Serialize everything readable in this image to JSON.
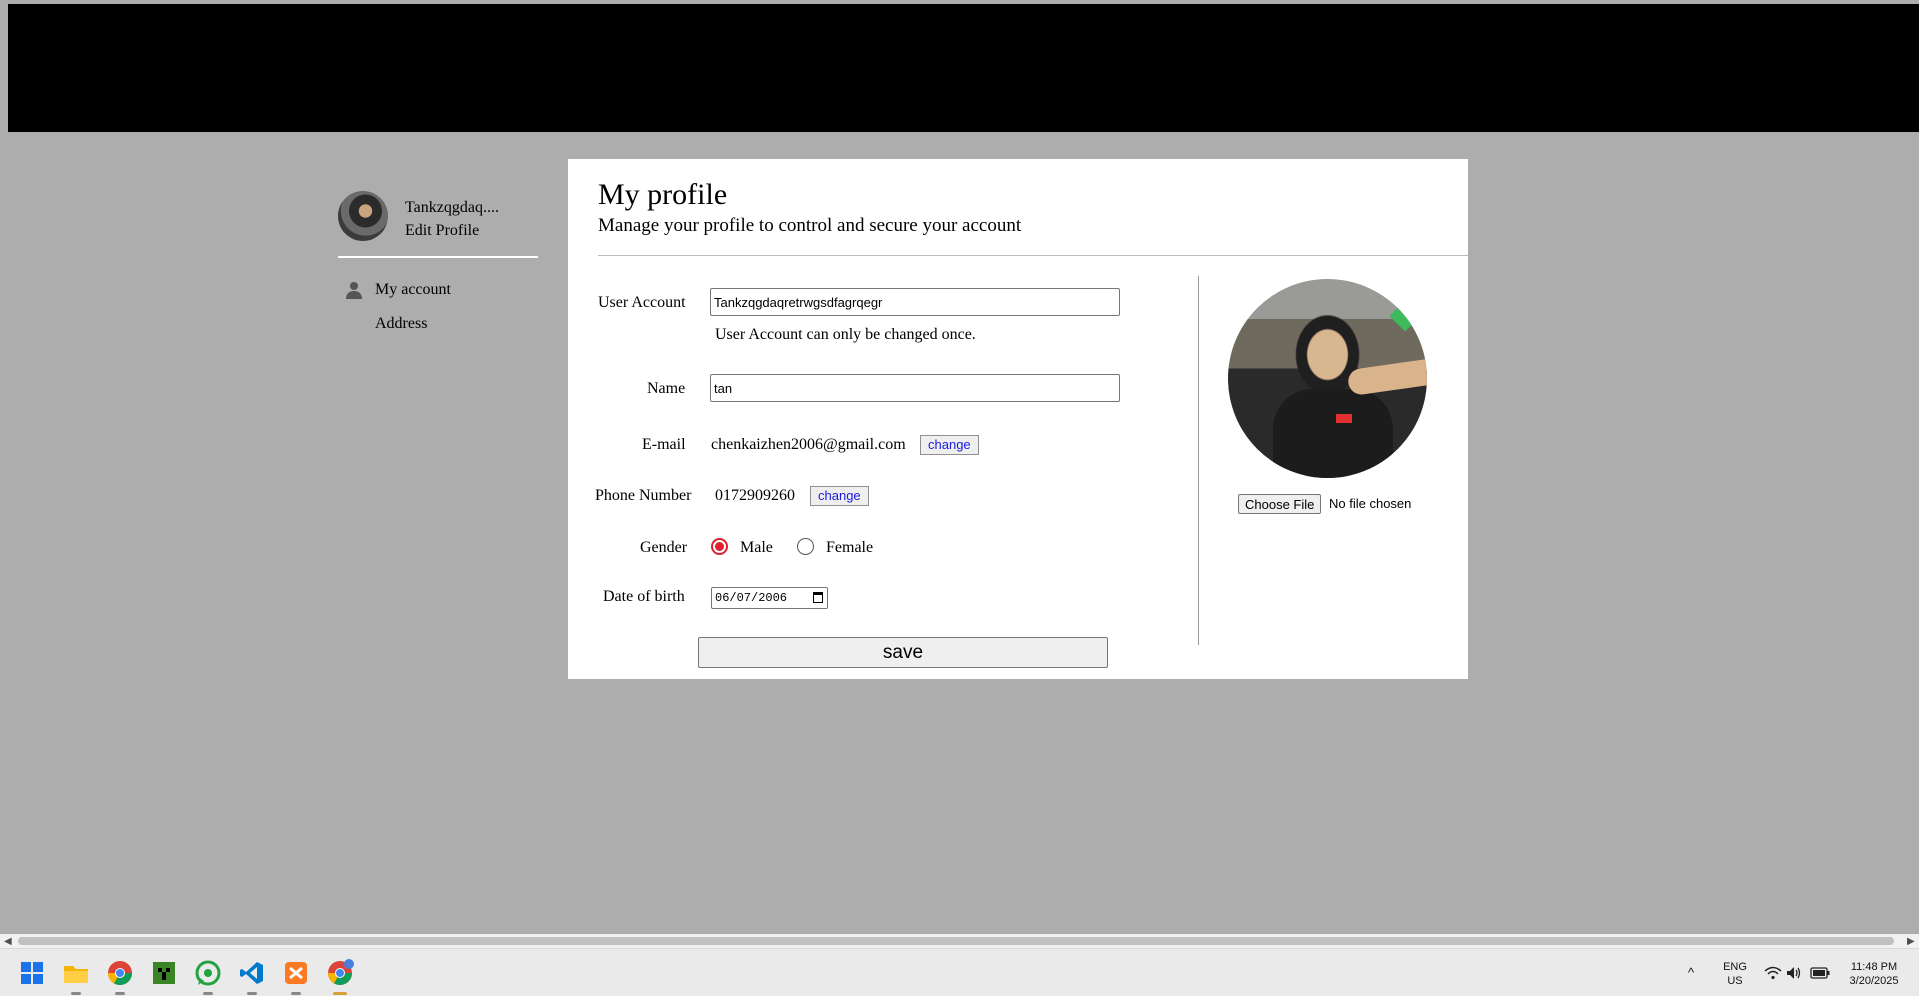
{
  "sidebar": {
    "username": "Tankzqgdaq....",
    "edit_profile": "Edit Profile",
    "items": [
      {
        "label": "My account",
        "icon": "person-icon"
      },
      {
        "label": "Address"
      }
    ]
  },
  "profile": {
    "title": "My profile",
    "subtitle": "Manage your profile to control and secure your account",
    "fields": {
      "user_account_label": "User Account",
      "user_account_value": "Tankzqgdaqretrwgsdfagrqegr",
      "user_account_note": "User Account can only be changed once.",
      "name_label": "Name",
      "name_value": "tan",
      "email_label": "E-mail",
      "email_value": "chenkaizhen2006@gmail.com",
      "email_change": "change",
      "phone_label": "Phone Number",
      "phone_value": "0172909260",
      "phone_change": "change",
      "gender_label": "Gender",
      "gender_options": [
        "Male",
        "Female"
      ],
      "gender_selected": "Male",
      "dob_label": "Date of birth",
      "dob_value": "06/07/2006"
    },
    "save_label": "save",
    "avatar": {
      "choose_file": "Choose File",
      "file_status": "No file chosen"
    }
  },
  "taskbar": {
    "apps": [
      "windows-start-icon",
      "file-explorer-icon",
      "chrome-icon",
      "minecraft-icon",
      "whatsapp-icon",
      "vscode-icon",
      "xampp-icon",
      "chrome-profile-icon"
    ],
    "lang_top": "ENG",
    "lang_bottom": "US",
    "time": "11:48 PM",
    "date": "3/20/2025"
  },
  "colors": {
    "page_bg": "#adadad",
    "header_bg": "#000000",
    "radio_accent": "#e0202a",
    "link_blue": "#1a1ae0"
  }
}
